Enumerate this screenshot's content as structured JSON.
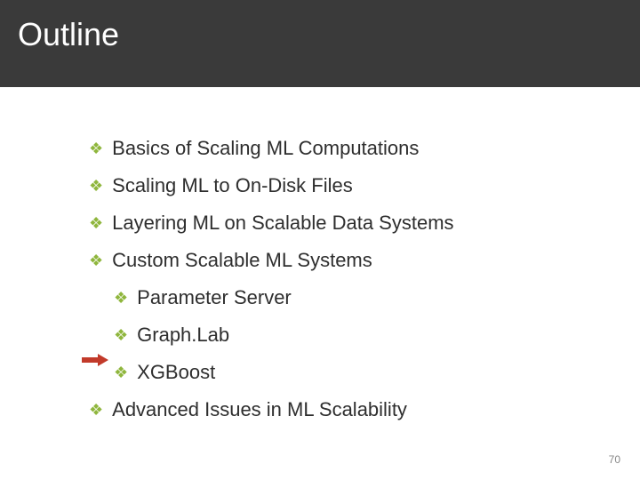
{
  "header": {
    "title": "Outline"
  },
  "items": {
    "b0": "Basics of Scaling ML Computations",
    "b1": "Scaling ML to On-Disk Files",
    "b2": "Layering ML on Scalable Data Systems",
    "b3": "Custom Scalable ML Systems",
    "b3_0": "Parameter Server",
    "b3_1": "Graph.Lab",
    "b3_2": "XGBoost",
    "b4": "Advanced Issues in ML Scalability"
  },
  "colors": {
    "accent": "#8fb63d",
    "arrow": "#c23a2a",
    "header_bg": "#3a3a3a"
  },
  "page_number": "70"
}
